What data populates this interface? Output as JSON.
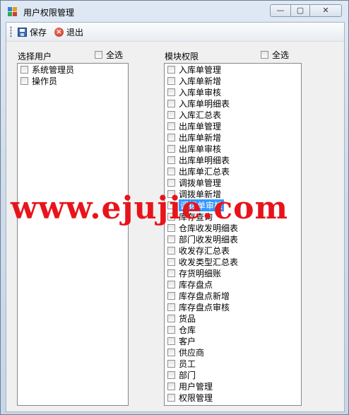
{
  "window": {
    "title": "用户权限管理",
    "min_glyph": "—",
    "max_glyph": "▢",
    "close_glyph": "✕"
  },
  "toolbar": {
    "save_label": "保存",
    "exit_label": "退出"
  },
  "users_panel": {
    "label": "选择用户",
    "check_all_label": "全选",
    "items": [
      {
        "label": "系统管理员",
        "checked": false
      },
      {
        "label": "操作员",
        "checked": false
      }
    ]
  },
  "modules_panel": {
    "label": "模块权限",
    "check_all_label": "全选",
    "items": [
      {
        "label": "入库单管理",
        "checked": false
      },
      {
        "label": "入库单新增",
        "checked": false
      },
      {
        "label": "入库单审核",
        "checked": false
      },
      {
        "label": "入库单明细表",
        "checked": false
      },
      {
        "label": "入库汇总表",
        "checked": false
      },
      {
        "label": "出库单管理",
        "checked": false
      },
      {
        "label": "出库单新增",
        "checked": false
      },
      {
        "label": "出库单审核",
        "checked": false
      },
      {
        "label": "出库单明细表",
        "checked": false
      },
      {
        "label": "出库单汇总表",
        "checked": false
      },
      {
        "label": "调拨单管理",
        "checked": false
      },
      {
        "label": "调拨单新增",
        "checked": false
      },
      {
        "label": "调拨单审核",
        "checked": false,
        "selected": true
      },
      {
        "label": "库存查询",
        "checked": false
      },
      {
        "label": "仓库收发明细表",
        "checked": false
      },
      {
        "label": "部门收发明细表",
        "checked": false
      },
      {
        "label": "收发存汇总表",
        "checked": false
      },
      {
        "label": "收发类型汇总表",
        "checked": false
      },
      {
        "label": "存货明细账",
        "checked": false
      },
      {
        "label": "库存盘点",
        "checked": false
      },
      {
        "label": "库存盘点新增",
        "checked": false
      },
      {
        "label": "库存盘点审核",
        "checked": false
      },
      {
        "label": "货品",
        "checked": false
      },
      {
        "label": "仓库",
        "checked": false
      },
      {
        "label": "客户",
        "checked": false
      },
      {
        "label": "供应商",
        "checked": false
      },
      {
        "label": "员工",
        "checked": false
      },
      {
        "label": "部门",
        "checked": false
      },
      {
        "label": "用户管理",
        "checked": false
      },
      {
        "label": "权限管理",
        "checked": false
      }
    ]
  },
  "watermark": "www.ejujie.com",
  "colors": {
    "selection": "#3399ff",
    "watermark": "#e8141b"
  }
}
